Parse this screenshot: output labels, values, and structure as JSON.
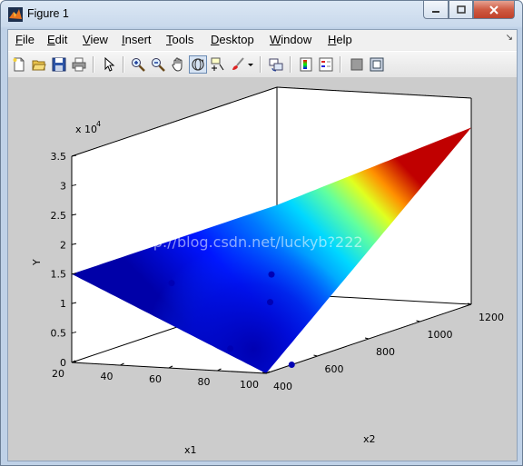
{
  "window": {
    "title": "Figure 1"
  },
  "menu": {
    "items": [
      {
        "id": "file",
        "accel": "F",
        "rest": "ile"
      },
      {
        "id": "edit",
        "accel": "E",
        "rest": "dit"
      },
      {
        "id": "view",
        "accel": "V",
        "rest": "iew"
      },
      {
        "id": "insert",
        "accel": "I",
        "rest": "nsert"
      },
      {
        "id": "tools",
        "accel": "T",
        "rest": "ools"
      },
      {
        "id": "desktop",
        "accel": "D",
        "rest": "esktop"
      },
      {
        "id": "window",
        "accel": "W",
        "rest": "indow"
      },
      {
        "id": "help",
        "accel": "H",
        "rest": "elp"
      }
    ]
  },
  "toolbar": {
    "buttons": [
      "new-figure-icon",
      "open-file-icon",
      "save-icon",
      "print-icon",
      "edit-plot-arrow-icon",
      "zoom-in-icon",
      "zoom-out-icon",
      "pan-hand-icon",
      "rotate-3d-icon",
      "data-cursor-icon",
      "brush-icon",
      "link-plot-icon",
      "colorbar-icon",
      "legend-icon",
      "hide-plot-tools-icon",
      "show-plot-tools-icon"
    ],
    "active": "rotate-3d-icon"
  },
  "chart_data": {
    "type": "surface",
    "title": "",
    "xlabel": "x1",
    "ylabel": "x2",
    "zlabel": "Y",
    "exponent_label_base": "x 10",
    "exponent_label_power": "4",
    "x_ticks": [
      "20",
      "40",
      "60",
      "80",
      "100"
    ],
    "y_ticks": [
      "400",
      "600",
      "800",
      "1000",
      "1200"
    ],
    "z_ticks": [
      "0",
      "0.5",
      "1",
      "1.5",
      "2",
      "2.5",
      "3",
      "3.5"
    ],
    "xlim": [
      20,
      100
    ],
    "ylim": [
      400,
      1200
    ],
    "zlim": [
      0,
      35000
    ],
    "grid": true,
    "colormap": "jet",
    "surface_corners": [
      {
        "x1": 20,
        "x2": 400,
        "Y": 15000
      },
      {
        "x1": 100,
        "x2": 400,
        "Y": 0
      },
      {
        "x1": 100,
        "x2": 1200,
        "Y": 30000
      },
      {
        "x1": 20,
        "x2": 1200,
        "Y": 15000
      }
    ],
    "surface_min": {
      "x1": 80,
      "x2": 500,
      "Y": 0
    },
    "points": [
      {
        "x1": 60,
        "x2": 800,
        "Y": 10000
      },
      {
        "x1": 40,
        "x2": 600,
        "Y": 11000
      },
      {
        "x1": 70,
        "x2": 700,
        "Y": 7000
      },
      {
        "x1": 80,
        "x2": 450,
        "Y": 3000
      },
      {
        "x1": 100,
        "x2": 500,
        "Y": 0
      }
    ],
    "watermark": "http://blog.csdn.net/luckyb?222"
  }
}
